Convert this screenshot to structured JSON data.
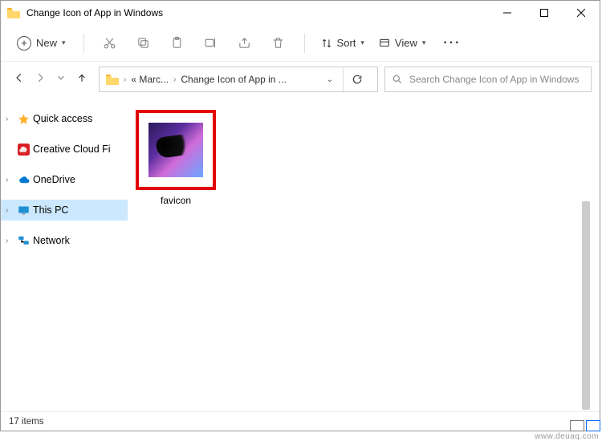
{
  "titlebar": {
    "title": "Change Icon of App in Windows"
  },
  "toolbar": {
    "new_label": "New",
    "sort_label": "Sort",
    "view_label": "View"
  },
  "address": {
    "crumb1": "« Marc...",
    "crumb2": "Change Icon of App in ..."
  },
  "search": {
    "placeholder": "Search Change Icon of App in Windows"
  },
  "sidebar": {
    "items": [
      {
        "label": "Quick access"
      },
      {
        "label": "Creative Cloud Fi"
      },
      {
        "label": "OneDrive"
      },
      {
        "label": "This PC"
      },
      {
        "label": "Network"
      }
    ]
  },
  "content": {
    "file_label": "favicon"
  },
  "status": {
    "count_text": "17 items"
  },
  "watermark": "www.deuaq.com"
}
